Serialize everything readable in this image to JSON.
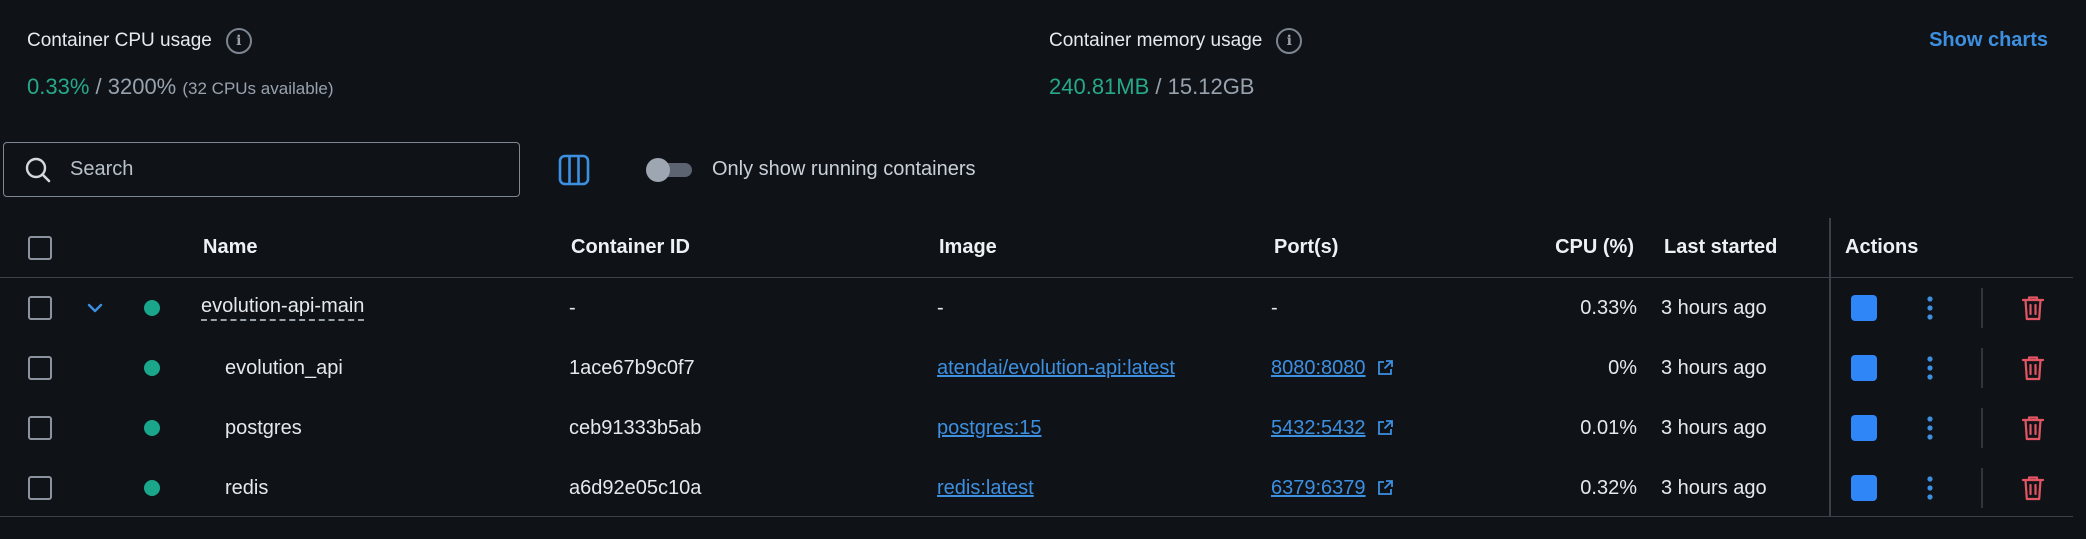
{
  "stats": {
    "cpu": {
      "label": "Container CPU usage",
      "used": "0.33%",
      "separator": " / ",
      "total": "3200%",
      "note": "(32 CPUs available)"
    },
    "memory": {
      "label": "Container memory usage",
      "used": "240.81MB",
      "separator": " / ",
      "total": "15.12GB"
    },
    "show_charts": "Show charts"
  },
  "toolbar": {
    "search_placeholder": "Search",
    "toggle_label": "Only show running containers",
    "toggle_on": false
  },
  "table": {
    "headers": {
      "name": "Name",
      "container_id": "Container ID",
      "image": "Image",
      "ports": "Port(s)",
      "cpu": "CPU (%)",
      "last_started": "Last started",
      "actions": "Actions"
    },
    "rows": [
      {
        "name": "evolution-api-main",
        "container_id": "-",
        "image": "-",
        "ports": "-",
        "cpu": "0.33%",
        "last_started": "3 hours ago"
      },
      {
        "name": "evolution_api",
        "container_id": "1ace67b9c0f7",
        "image": "atendai/evolution-api:latest",
        "ports": "8080:8080",
        "cpu": "0%",
        "last_started": "3 hours ago"
      },
      {
        "name": "postgres",
        "container_id": "ceb91333b5ab",
        "image": "postgres:15",
        "ports": "5432:5432",
        "cpu": "0.01%",
        "last_started": "3 hours ago"
      },
      {
        "name": "redis",
        "container_id": "a6d92e05c10a",
        "image": "redis:latest",
        "ports": "6379:6379",
        "cpu": "0.32%",
        "last_started": "3 hours ago"
      }
    ]
  },
  "colors": {
    "background": "#0f1318",
    "accent": "#3d8fe0",
    "status_running": "#1aa68a",
    "danger": "#e25563",
    "stop_button": "#2f86f6"
  },
  "icons": {
    "info": "info-icon",
    "search": "search-icon",
    "columns": "columns-icon",
    "expand": "chevron-down-icon",
    "external": "external-link-icon",
    "stop": "stop-icon",
    "more": "kebab-menu-icon",
    "delete": "trash-icon"
  }
}
